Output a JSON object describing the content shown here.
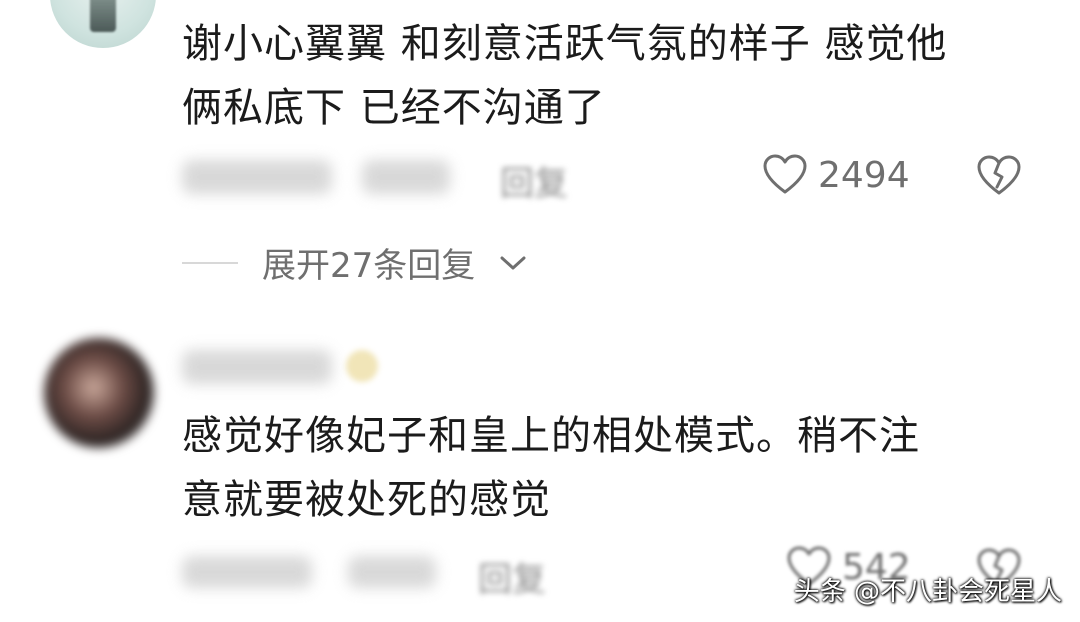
{
  "comments": [
    {
      "text_line1": "谢小心翼翼 和刻意活跃气氛的样子  感觉他",
      "text_line2": "俩私底下 已经不沟通了",
      "likes": "2494",
      "reply_label": "回复"
    },
    {
      "text_line1": "感觉好像妃子和皇上的相处模式。稍不注",
      "text_line2": "意就要被处死的感觉",
      "likes": "542",
      "reply_label": "回复"
    }
  ],
  "expand_replies_label": "展开27条回复",
  "watermark": "头条 @不八卦会死星人",
  "icons": {
    "like": "heart-outline-icon",
    "dislike": "broken-heart-icon",
    "expand": "chevron-down-icon"
  },
  "colors": {
    "text": "#1b1b1b",
    "muted": "#6f6f6f",
    "background": "#ffffff"
  }
}
